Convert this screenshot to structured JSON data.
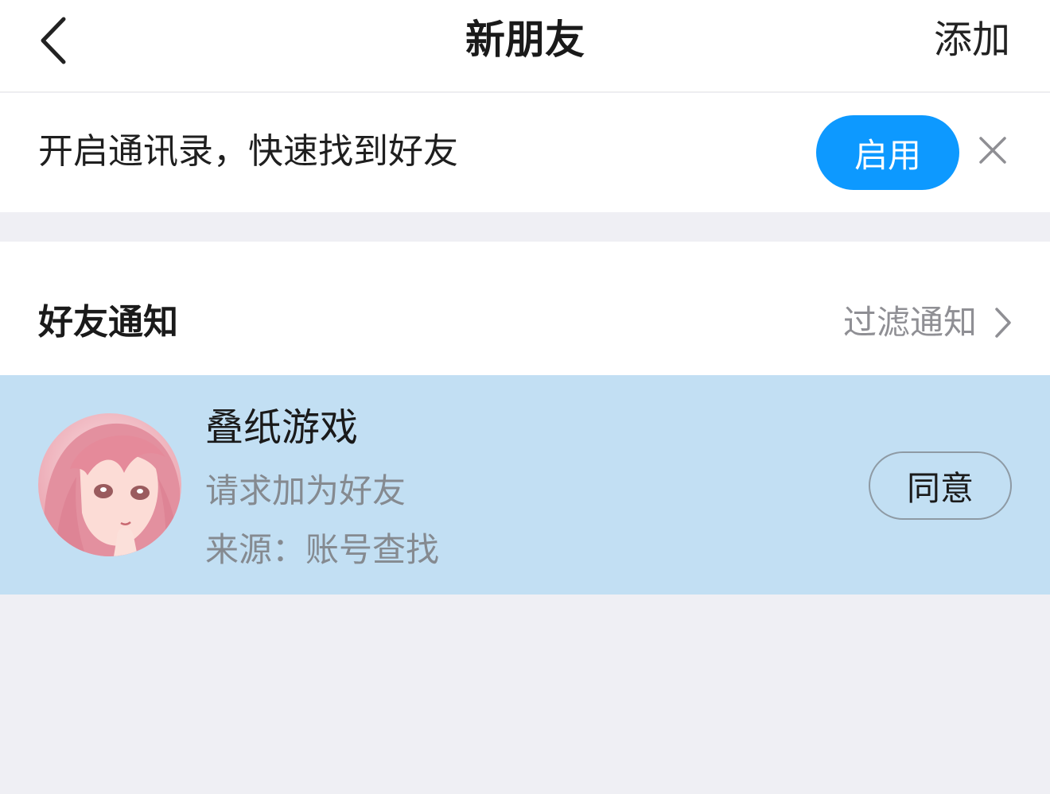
{
  "navbar": {
    "back_icon": "chevron-left-icon",
    "title": "新朋友",
    "add_label": "添加"
  },
  "contacts_banner": {
    "text": "开启通讯录，快速找到好友",
    "enable_label": "启用",
    "close_icon": "close-icon",
    "enable_color": "#0d99ff"
  },
  "friend_notifications": {
    "title": "好友通知",
    "filter_label": "过滤通知",
    "filter_icon": "chevron-right-icon"
  },
  "requests": [
    {
      "name": "叠纸游戏",
      "message": "请求加为好友",
      "source": "来源：账号查找",
      "agree_label": "同意",
      "avatar": "avatar-anime-girl-pink-hair",
      "highlight_color": "#c2dff3"
    }
  ]
}
